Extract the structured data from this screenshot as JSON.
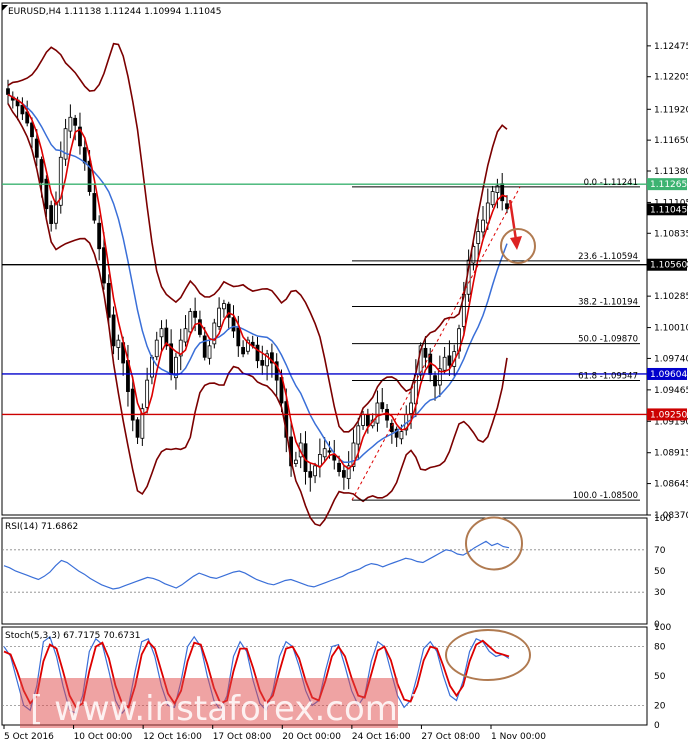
{
  "chart_data": {
    "type": "candlestick",
    "symbol": "EURUSD,H4",
    "header_values": "1.11138 1.11244 1.10994 1.11045",
    "ylim": [
      1.0837,
      1.1285
    ],
    "price_ticks": [
      "1.12475",
      "1.12205",
      "1.11920",
      "1.11650",
      "1.11380",
      "1.11105",
      "1.10835",
      "1.10560",
      "1.10285",
      "1.10010",
      "1.09740",
      "1.09465",
      "1.09190",
      "1.08915",
      "1.08645",
      "1.08370"
    ],
    "x_ticks": [
      "5 Oct 2016",
      "10 Oct 00:00",
      "12 Oct 16:00",
      "17 Oct 08:00",
      "20 Oct 00:00",
      "24 Oct 16:00",
      "27 Oct 08:00",
      "1 Nov 00:00"
    ],
    "closes": [
      1.1205,
      1.12,
      1.1195,
      1.1188,
      1.118,
      1.1168,
      1.115,
      1.1128,
      1.1105,
      1.1092,
      1.111,
      1.115,
      1.1175,
      1.1185,
      1.1178,
      1.116,
      1.1145,
      1.112,
      1.1095,
      1.107,
      1.104,
      1.101,
      1.0985,
      1.099,
      1.097,
      1.0945,
      1.092,
      1.0905,
      1.093,
      1.0955,
      1.0975,
      1.099,
      1.1,
      1.0985,
      1.096,
      1.0975,
      1.099,
      1.1,
      1.1015,
      1.101,
      1.0995,
      1.0975,
      1.0985,
      1.1005,
      1.1018,
      1.1022,
      1.101,
      1.0998,
      1.0985,
      1.0978,
      1.099,
      1.0985,
      1.0972,
      1.0968,
      1.0978,
      1.097,
      1.0955,
      1.0935,
      1.0905,
      1.088,
      1.0885,
      1.09,
      1.0875,
      1.087,
      1.088,
      1.089,
      1.0895,
      1.0892,
      1.0885,
      1.0875,
      1.087,
      1.088,
      1.09,
      1.0915,
      1.0925,
      1.0915,
      1.092,
      1.0935,
      1.093,
      1.092,
      1.091,
      1.0905,
      1.091,
      1.0925,
      1.0935,
      1.096,
      1.0985,
      1.0975,
      1.096,
      1.095,
      1.0965,
      1.0975,
      1.0968,
      1.098,
      1.1,
      1.103,
      1.106,
      1.1072,
      1.1085,
      1.1095,
      1.111,
      1.112,
      1.1125,
      1.1112,
      1.1105
    ],
    "levels": [
      {
        "label": "1.11265",
        "value": 1.11265,
        "color": "#3cb371"
      },
      {
        "label": "1.10560",
        "value": 1.1056,
        "color": "#000000"
      },
      {
        "label": "1.09604",
        "value": 1.09604,
        "color": "#0000cc"
      },
      {
        "label": "1.09250",
        "value": 1.0925,
        "color": "#cc0000"
      }
    ],
    "current_price": {
      "label": "1.11045",
      "value": 1.11045
    },
    "fibonacci": [
      {
        "label": "0.0 -1.11241",
        "value": 1.11241
      },
      {
        "label": "23.6 -1.10594",
        "value": 1.10594
      },
      {
        "label": "38.2 -1.10194",
        "value": 1.10194
      },
      {
        "label": "50.0 -1.09870",
        "value": 1.0987
      },
      {
        "label": "61.8 -1.09547",
        "value": 1.09547
      },
      {
        "label": "100.0 -1.08500",
        "value": 1.085
      }
    ],
    "rsi": {
      "title": "RSI(14) 71.6862",
      "ticks": [
        "100",
        "70",
        "50",
        "30",
        "0"
      ],
      "values": [
        55,
        53,
        50,
        48,
        46,
        44,
        42,
        45,
        49,
        55,
        60,
        58,
        54,
        50,
        47,
        43,
        40,
        37,
        35,
        33,
        34,
        36,
        38,
        40,
        42,
        44,
        43,
        41,
        38,
        36,
        34,
        37,
        41,
        45,
        48,
        46,
        44,
        43,
        45,
        47,
        49,
        50,
        48,
        45,
        42,
        40,
        38,
        37,
        39,
        41,
        42,
        40,
        38,
        36,
        35,
        37,
        39,
        41,
        43,
        45,
        48,
        50,
        52,
        55,
        57,
        56,
        54,
        56,
        58,
        60,
        62,
        61,
        59,
        58,
        61,
        64,
        67,
        70,
        69,
        66,
        65,
        68,
        72,
        75,
        78,
        74,
        76,
        73,
        72
      ]
    },
    "stoch": {
      "title": "Stoch(5,3,3) 67.7175 70.6731",
      "ticks": [
        "100",
        "80",
        "50",
        "20",
        "0"
      ],
      "main": [
        80,
        70,
        45,
        20,
        15,
        40,
        85,
        90,
        70,
        40,
        15,
        12,
        30,
        75,
        88,
        82,
        55,
        25,
        12,
        20,
        55,
        85,
        88,
        70,
        40,
        20,
        18,
        45,
        80,
        90,
        80,
        50,
        25,
        15,
        30,
        70,
        85,
        75,
        45,
        22,
        15,
        35,
        70,
        85,
        80,
        60,
        35,
        20,
        25,
        55,
        80,
        82,
        60,
        35,
        20,
        30,
        65,
        85,
        80,
        55,
        30,
        18,
        25,
        50,
        78,
        85,
        75,
        50,
        30,
        25,
        45,
        75,
        88,
        85,
        75,
        70,
        72,
        68
      ],
      "signal": [
        75,
        72,
        55,
        35,
        22,
        30,
        65,
        82,
        78,
        55,
        30,
        18,
        22,
        55,
        80,
        84,
        68,
        40,
        22,
        18,
        40,
        72,
        85,
        78,
        55,
        32,
        22,
        35,
        65,
        84,
        82,
        62,
        38,
        22,
        25,
        55,
        78,
        78,
        58,
        35,
        22,
        30,
        55,
        78,
        80,
        68,
        45,
        28,
        25,
        45,
        70,
        80,
        70,
        48,
        30,
        28,
        52,
        76,
        80,
        66,
        42,
        26,
        24,
        40,
        66,
        80,
        78,
        60,
        40,
        30,
        40,
        65,
        82,
        86,
        80,
        74,
        72,
        70
      ]
    },
    "watermark": "[ www.instaforex.com ]"
  }
}
